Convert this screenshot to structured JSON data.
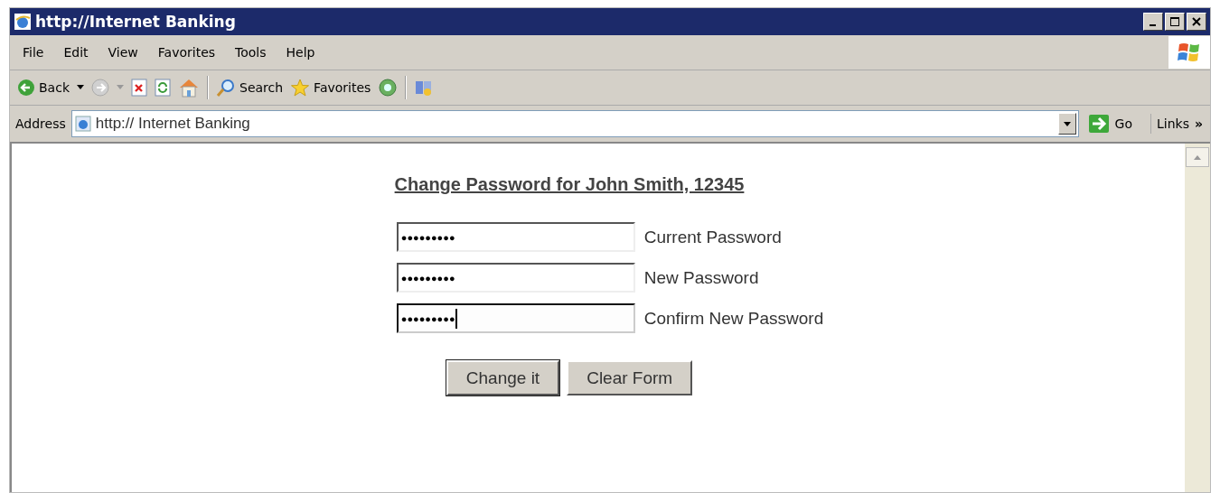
{
  "window": {
    "title": "http://Internet Banking"
  },
  "menu": [
    "File",
    "Edit",
    "View",
    "Favorites",
    "Tools",
    "Help"
  ],
  "toolbar": {
    "back": "Back",
    "search": "Search",
    "favorites": "Favorites"
  },
  "address_bar": {
    "label": "Address",
    "value": "http:// Internet Banking",
    "go": "Go",
    "links": "Links",
    "more": "»"
  },
  "page": {
    "heading": "Change Password for John Smith, 12345",
    "fields": [
      {
        "label": "Current Password",
        "value": "●●●●●●●●●",
        "focused": false
      },
      {
        "label": "New Password",
        "value": "●●●●●●●●●",
        "focused": false
      },
      {
        "label": "Confirm New Password",
        "value": "●●●●●●●●●",
        "focused": true
      }
    ],
    "buttons": [
      {
        "label": "Change it",
        "default": true
      },
      {
        "label": "Clear Form",
        "default": false
      }
    ]
  }
}
